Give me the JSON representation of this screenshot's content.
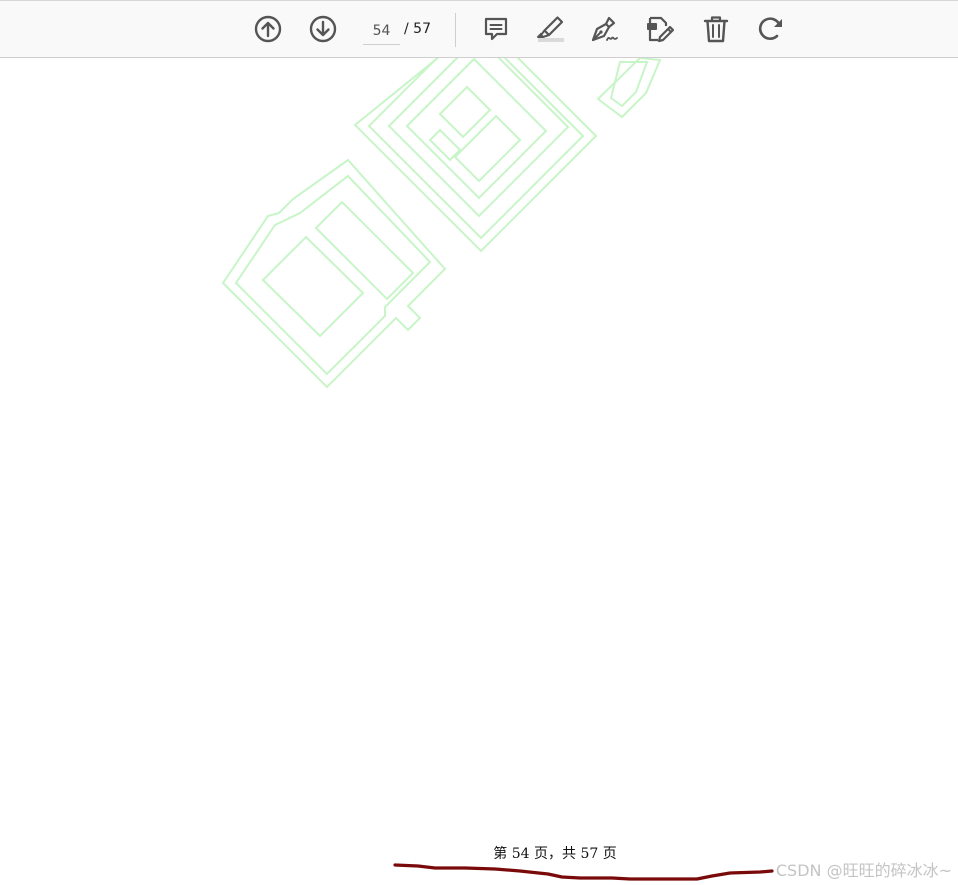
{
  "toolbar": {
    "prev_page_icon": "arrow-up-circle-icon",
    "next_page_icon": "arrow-down-circle-icon",
    "current_page": "54",
    "total_pages_label": "/ 57",
    "comment_icon": "comment-icon",
    "highlight_icon": "highlighter-icon",
    "draw_icon": "pen-draw-icon",
    "edit_icon": "edit-document-icon",
    "delete_icon": "trash-icon",
    "rotate_icon": "rotate-icon",
    "icon_color": "#555555"
  },
  "page": {
    "footer_text": "第 54 页，共 57 页",
    "watermark_color": "#c8f5c8",
    "annotation_color": "#7a0a0a"
  },
  "overlay": {
    "credit_text": "CSDN @旺旺的碎冰冰~"
  }
}
